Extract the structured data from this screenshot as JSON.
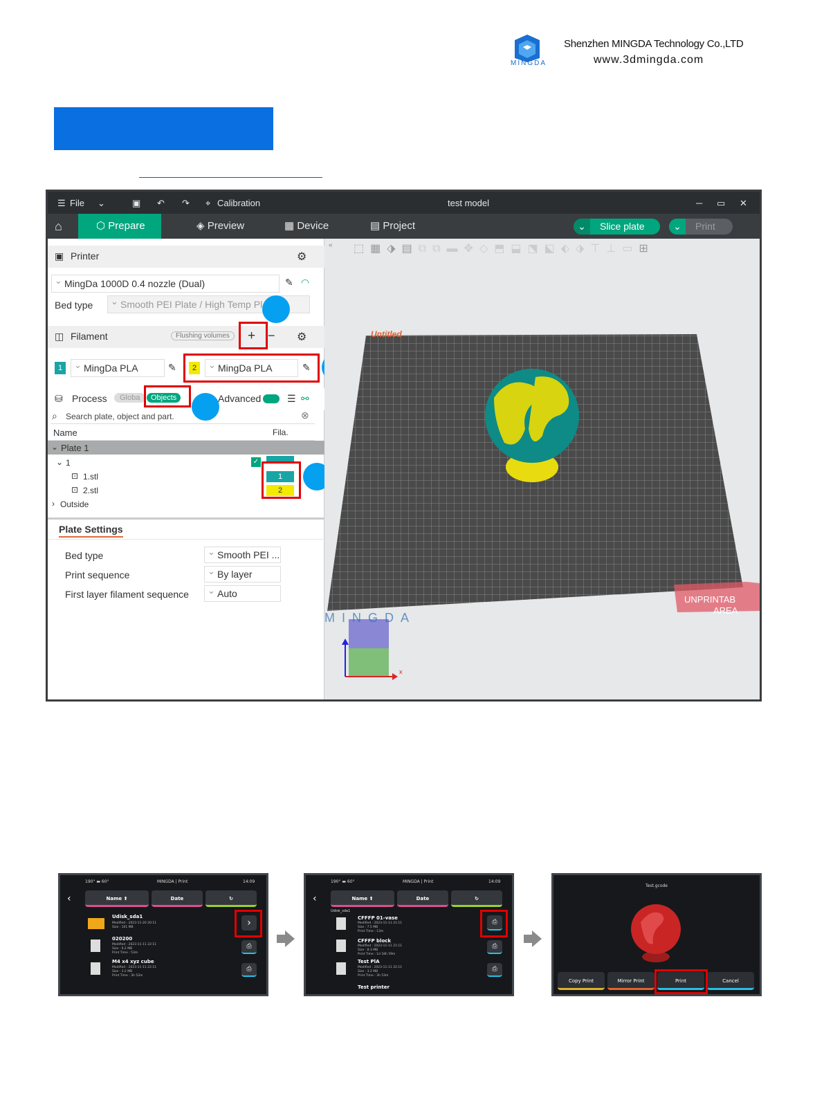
{
  "header": {
    "company": "Shenzhen MINGDA Technology Co.,LTD",
    "website": "www.3dmingda.com",
    "logo_text": "MINGDA"
  },
  "window": {
    "file_menu": "File",
    "calibration": "Calibration",
    "title": "test model",
    "tabs": [
      "Prepare",
      "Preview",
      "Device",
      "Project"
    ],
    "slice_button": "Slice plate",
    "print_button": "Print"
  },
  "left_panel": {
    "printer_label": "Printer",
    "printer_value": "MingDa 1000D 0.4 nozzle (Dual)",
    "bed_type_label": "Bed type",
    "bed_type_value": "Smooth PEI Plate / High Temp Pl",
    "filament_label": "Filament",
    "flushing_volumes": "Flushing volumes",
    "filaments": [
      {
        "index": "1",
        "name": "MingDa PLA",
        "color": "#1aa5a5"
      },
      {
        "index": "2",
        "name": "MingDa PLA",
        "color": "#f2ea00"
      }
    ],
    "process_label": "Process",
    "global_tab": "Globa",
    "objects_tab": "Objects",
    "advanced_label": "Advanced",
    "search_placeholder": "Search plate, object and part.",
    "col_name": "Name",
    "col_fila": "Fila.",
    "tree": {
      "plate": "Plate 1",
      "object": "1",
      "parts": [
        {
          "name": "1.stl",
          "fila": "1"
        },
        {
          "name": "2.stl",
          "fila": "2"
        }
      ],
      "outside": "Outside"
    },
    "plate_settings_title": "Plate Settings",
    "plate_settings": [
      {
        "label": "Bed type",
        "value": "Smooth PEI ..."
      },
      {
        "label": "Print sequence",
        "value": "By layer"
      },
      {
        "label": "First layer filament sequence",
        "value": "Auto"
      }
    ]
  },
  "viewport": {
    "plate_label": "Untitled",
    "unprintable_line1": "UNPRINTAB",
    "unprintable_line2": "AREA",
    "bed_watermark": "MINGDA",
    "axis_x": "x"
  },
  "screens": [
    {
      "temps": "190°  ▬ 60°",
      "brand": "MINGDA | Print",
      "time": "14:09",
      "btn_name": "Name ⬆",
      "btn_date": "Date",
      "folder": "Udisk_sda1",
      "items": [
        {
          "name": "Udisk_sda1",
          "meta": [
            "Modified : 2023-11-20 20:11",
            "Size : 101 MB"
          ]
        },
        {
          "name": "020200",
          "meta": [
            "Modified : 2023-11-11 22:11",
            "Size : 9.2 MB",
            "Print Time : 53m"
          ]
        },
        {
          "name": "M4 x4 xyz cube",
          "meta": [
            "Modified : 2023-11-11 22:11",
            "Size : 3.2 MB",
            "Print Time : 3h 53m"
          ]
        }
      ]
    },
    {
      "temps": "190°  ▬ 60°",
      "brand": "MINGDA | Print",
      "time": "14:09",
      "btn_name": "Name ⬆",
      "btn_date": "Date",
      "folder": "Udisk_sda1",
      "items": [
        {
          "name": "CFFFP 01-vase",
          "meta": [
            "Modified : 2023-11-11 21:11",
            "Size : 7.5 MB",
            "Print Time : 13m"
          ]
        },
        {
          "name": "CFFFP block",
          "meta": [
            "Modified : 2023-11-11 21:11",
            "Size : 8.3 MB",
            "Print Time : 1d 18h 59m"
          ]
        },
        {
          "name": "Test PlA",
          "meta": [
            "Modified : 2023-11-11 22:11",
            "Size : 3.2 MB",
            "Print Time : 3h 53m"
          ]
        },
        {
          "name": "Test printer",
          "meta": []
        }
      ]
    },
    {
      "file": "Test.gcode",
      "buttons": [
        "Copy Print",
        "Mirror Print",
        "Print",
        "Cancel"
      ]
    }
  ]
}
